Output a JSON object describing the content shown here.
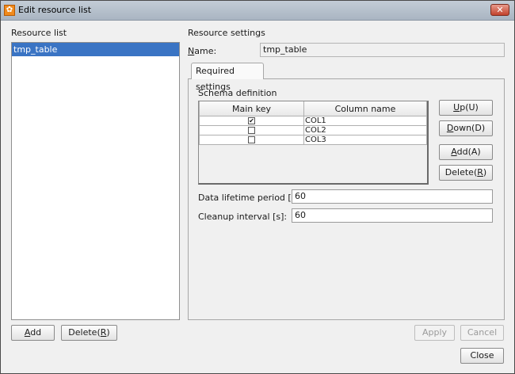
{
  "window": {
    "title": "Edit resource list",
    "close_glyph": "✕",
    "app_icon": "resource-app-icon"
  },
  "left": {
    "heading": "Resource list",
    "items": [
      {
        "label": "tmp_table",
        "selected": true
      }
    ],
    "add_button": {
      "accel": "A",
      "rest": "dd"
    },
    "delete_button": {
      "pre": "Delete(",
      "accel": "R",
      "post": ")"
    }
  },
  "right": {
    "heading": "Resource settings",
    "name_label": {
      "accel": "N",
      "rest": "ame:"
    },
    "name_value": "tmp_table",
    "tab_label": "Required settings",
    "schema": {
      "heading": "Schema definition",
      "columns": [
        "Main key",
        "Column name"
      ],
      "rows": [
        {
          "main_key": true,
          "column_name": "COL1"
        },
        {
          "main_key": false,
          "column_name": "COL2"
        },
        {
          "main_key": false,
          "column_name": "COL3"
        }
      ],
      "check_glyph": "✔"
    },
    "side_buttons": {
      "up": {
        "accel": "U",
        "post": "p(U)"
      },
      "down": {
        "accel": "D",
        "post": "own(D)"
      },
      "add": {
        "accel": "A",
        "post": "dd(A)"
      },
      "delete": {
        "pre": "Delete(",
        "accel": "R",
        "post": ")"
      }
    },
    "lifetime_label": "Data lifetime period [s]:",
    "lifetime_value": "60",
    "cleanup_label": "Cleanup interval [s]:",
    "cleanup_value": "60"
  },
  "footer": {
    "apply": "Apply",
    "cancel": "Cancel",
    "close": "Close"
  }
}
